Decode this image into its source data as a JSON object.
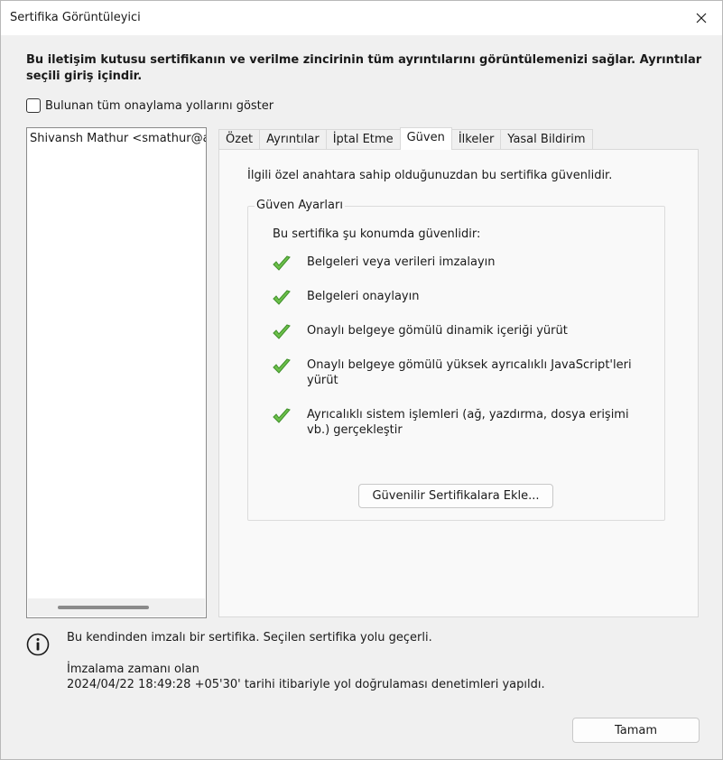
{
  "window": {
    "title": "Sertifika Görüntüleyici",
    "close_icon": "close-icon"
  },
  "description": "Bu iletişim kutusu sertifikanın ve verilme zincirinin tüm ayrıntılarını görüntülemenizi sağlar. Ayrıntılar seçili giriş içindir.",
  "show_all_paths": {
    "label": "Bulunan tüm onaylama yollarını göster",
    "checked": false
  },
  "tree": {
    "items": [
      "Shivansh Mathur <smathur@a"
    ]
  },
  "tabs": [
    {
      "label": "Özet",
      "active": false
    },
    {
      "label": "Ayrıntılar",
      "active": false
    },
    {
      "label": "İptal Etme",
      "active": false
    },
    {
      "label": "Güven",
      "active": true
    },
    {
      "label": "İlkeler",
      "active": false
    },
    {
      "label": "Yasal Bildirim",
      "active": false
    }
  ],
  "trust_tab": {
    "trusted_text": "İlgili özel anahtara sahip olduğunuzdan bu sertifika güvenlidir.",
    "group_title": "Güven Ayarları",
    "intro": "Bu sertifika şu konumda güvenlidir:",
    "items": [
      "Belgeleri veya verileri imzalayın",
      "Belgeleri onaylayın",
      "Onaylı belgeye gömülü dinamik içeriği yürüt",
      "Onaylı belgeye gömülü yüksek ayrıcalıklı JavaScript'leri yürüt",
      "Ayrıcalıklı sistem işlemleri (ağ, yazdırma, dosya erişimi vb.) gerçekleştir"
    ],
    "add_button": "Güvenilir Sertifikalara Ekle..."
  },
  "status": {
    "icon": "info-icon",
    "message": "Bu kendinden imzalı bir sertifika. Seçilen sertifika yolu geçerli.",
    "sign_time_label": "İmzalama zamanı olan",
    "sign_time_detail": "2024/04/22 18:49:28 +05'30' tarihi itibariyle yol doğrulaması denetimleri yapıldı."
  },
  "ok_button": "Tamam",
  "colors": {
    "check_green": "#6cc04a",
    "window_bg": "#f0f0f0"
  }
}
